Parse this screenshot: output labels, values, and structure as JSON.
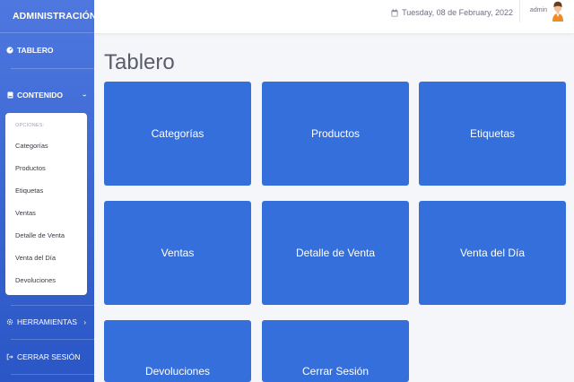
{
  "sidebar": {
    "brand": "ADMINISTRACIÓN",
    "tablero": "TABLERO",
    "contenido": "CONTENIDO",
    "submenu_header": "OPCIONES:",
    "submenu_items": [
      "Categorías",
      "Productos",
      "Etiquetas",
      "Ventas",
      "Detalle de Venta",
      "Venta del Día",
      "Devoluciones"
    ],
    "herramientas": "HERRAMIENTAS",
    "cerrar": "CERRAR SESIÓN"
  },
  "topbar": {
    "date": "Tuesday, 08 de February, 2022",
    "user": "admin"
  },
  "main": {
    "title": "Tablero",
    "tiles": [
      "Categorías",
      "Productos",
      "Etiquetas",
      "Ventas",
      "Detalle de Venta",
      "Venta del Día",
      "Devoluciones",
      "Cerrar Sesión"
    ]
  },
  "colors": {
    "sidebar_top": "#4e78df",
    "sidebar_bottom": "#2a56c6",
    "tile": "#356fdc",
    "background": "#f5f6fa"
  },
  "icons": {
    "tablero": "gauge-icon",
    "contenido": "folder-icon",
    "herramientas": "gear-icon",
    "cerrar": "logout-icon",
    "date": "calendar-icon",
    "user": "avatar"
  }
}
